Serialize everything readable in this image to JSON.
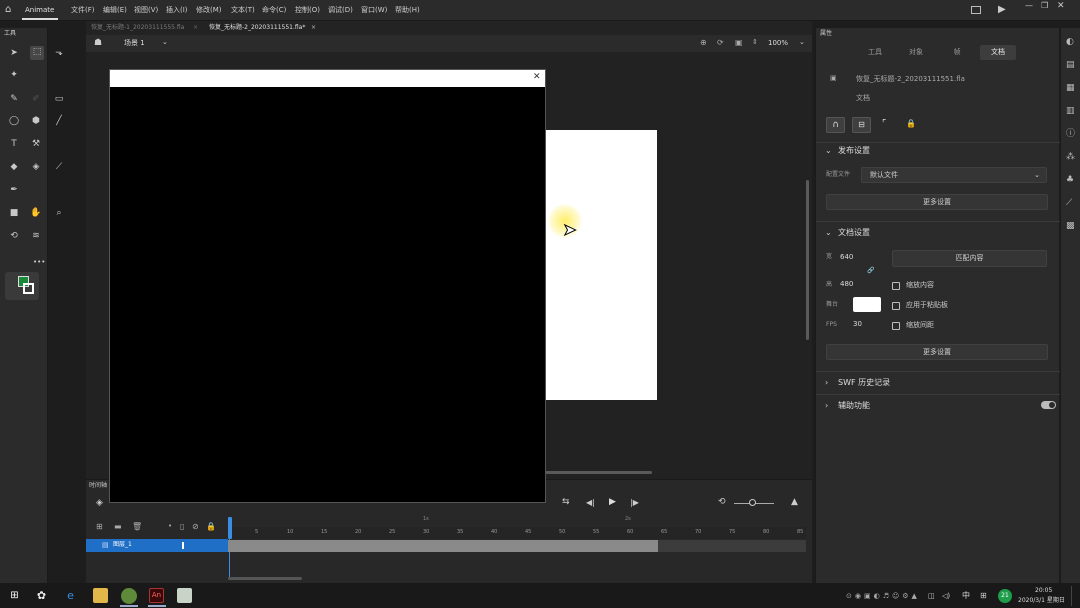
{
  "app": {
    "name": "Animate"
  },
  "menu": [
    "文件(F)",
    "编辑(E)",
    "视图(V)",
    "插入(I)",
    "修改(M)",
    "文本(T)",
    "命令(C)",
    "控制(O)",
    "调试(D)",
    "窗口(W)",
    "帮助(H)"
  ],
  "tabs": [
    {
      "label": "恢复_无标题-1_20203111555.fla",
      "active": false
    },
    {
      "label": "恢复_无标题-2_20203111551.fla*",
      "active": true
    }
  ],
  "editbar": {
    "scene": "场景 1",
    "zoom": "100%"
  },
  "tools": {
    "label": "工具",
    "more": "•••"
  },
  "timeline": {
    "label": "时间轴",
    "layer_name": "图层_1",
    "ruler_ticks": [
      "1",
      "5",
      "10",
      "15",
      "20",
      "25",
      "30",
      "35",
      "40",
      "45",
      "50",
      "55",
      "60",
      "65",
      "70",
      "75",
      "80",
      "85"
    ],
    "marker": "2s",
    "marker2": "1s"
  },
  "props": {
    "panel_title": "属性",
    "tabs": [
      "工具",
      "对象",
      "帧",
      "文档"
    ],
    "active_tab": "文档",
    "file_name": "恢复_无标题-2_20203111551.fla",
    "doc_label": "文档",
    "publish": {
      "title": "发布设置",
      "profile_label": "配置文件",
      "profile_value": "默认文件",
      "more": "更多设置"
    },
    "doc": {
      "title": "文档设置",
      "width_label": "宽",
      "width": "640",
      "height_label": "高",
      "height": "480",
      "match_btn": "匹配内容",
      "scale_content": "缩放内容",
      "stage_label": "舞台",
      "stage_color": "#ffffff",
      "apply_paste": "应用于粘贴板",
      "fps_label": "FPS",
      "fps": "30",
      "scale_spacing": "缩放间距",
      "more": "更多设置"
    },
    "swf": "SWF 历史记录",
    "access": "辅助功能"
  },
  "taskbar": {
    "time": "20:05",
    "date": "2020/3/1 星期日",
    "ime": "中",
    "badge": "21"
  },
  "colors": {
    "accent": "#1f6fc7",
    "stroke": "#ffffff",
    "fill": "#1a8a3a"
  }
}
